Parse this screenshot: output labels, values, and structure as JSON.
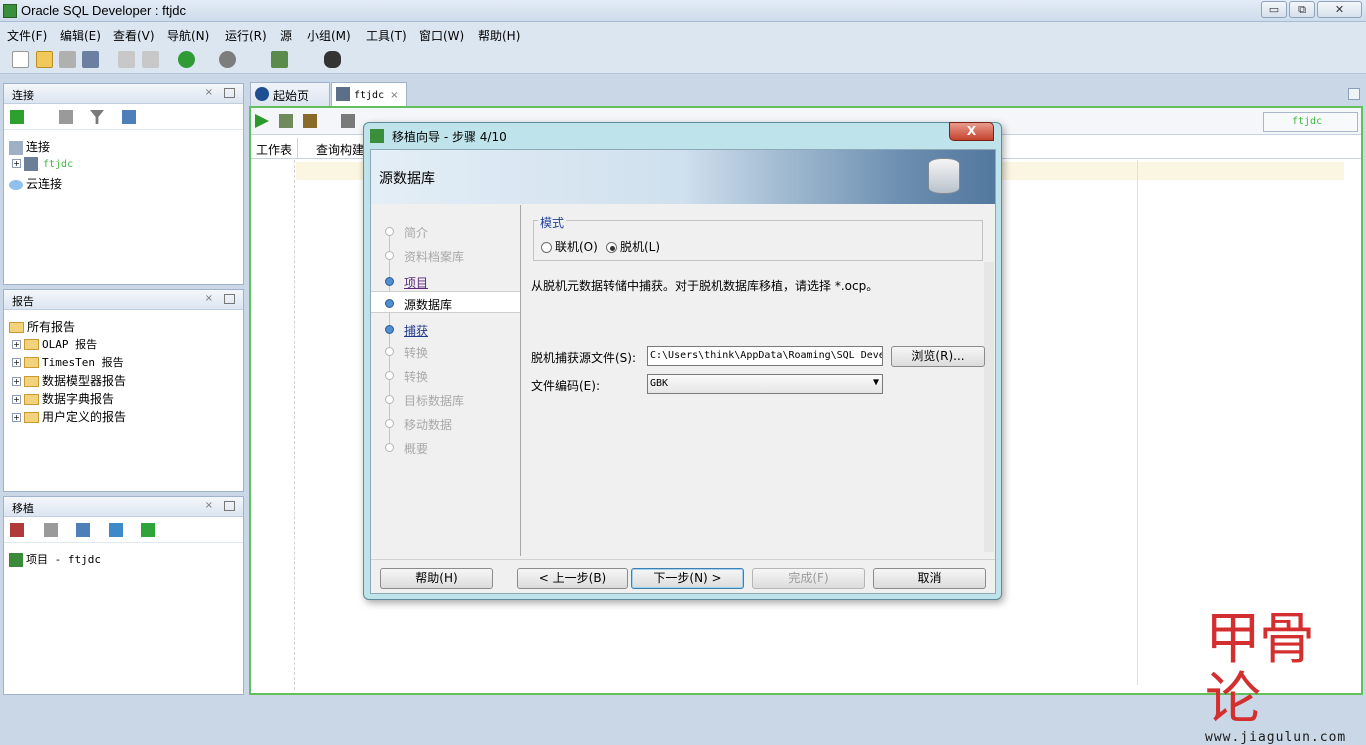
{
  "window": {
    "title": "Oracle SQL Developer : ftjdc",
    "min": "▭",
    "max": "⧉",
    "close": "✕"
  },
  "menubar": [
    "文件(F)",
    "编辑(E)",
    "查看(V)",
    "导航(N)",
    "运行(R)",
    "源",
    "小组(M)",
    "工具(T)",
    "窗口(W)",
    "帮助(H)"
  ],
  "panes": {
    "connections": {
      "header": "连接",
      "root": "连接",
      "child": "ftjdc",
      "cloud": "云连接"
    },
    "reports": {
      "header": "报告",
      "root": "所有报告",
      "items": [
        "OLAP 报告",
        "TimesTen 报告",
        "数据模型器报告",
        "数据字典报告",
        "用户定义的报告"
      ]
    },
    "migration": {
      "header": "移植",
      "project": "项目 - ftjdc"
    }
  },
  "editor": {
    "tabs": [
      "起始页",
      "ftjdc"
    ],
    "subtabs": [
      "工作表",
      "查询构建"
    ],
    "connection_combo": "ftjdc"
  },
  "dialog": {
    "title": "移植向导 - 步骤 4/10",
    "close": "X",
    "banner": "源数据库",
    "steps": [
      "简介",
      "资料档案库",
      "项目",
      "源数据库",
      "捕获",
      "转换",
      "转换",
      "目标数据库",
      "移动数据",
      "概要"
    ],
    "mode_group": "模式",
    "mode_online": "联机(O)",
    "mode_offline": "脱机(L)",
    "mode_selected": "offline",
    "info": "从脱机元数据转储中捕获。对于脱机数据库移植，请选择 *.ocp。",
    "source_file_label": "脱机捕获源文件(S):",
    "source_file_value": "C:\\Users\\think\\AppData\\Roaming\\SQL Deve",
    "browse": "浏览(R)...",
    "encoding_label": "文件编码(E):",
    "encoding_value": "GBK",
    "buttons": {
      "help": "帮助(H)",
      "back": "< 上一步(B)",
      "next": "下一步(N) >",
      "finish": "完成(F)",
      "cancel": "取消"
    }
  },
  "watermark": {
    "logo": "甲骨论",
    "url": "www.jiagulun.com"
  },
  "colors": {
    "accent_green": "#62c05c",
    "dialog_frame": "#bfe3ea",
    "watermark_red": "#d42f2f"
  }
}
